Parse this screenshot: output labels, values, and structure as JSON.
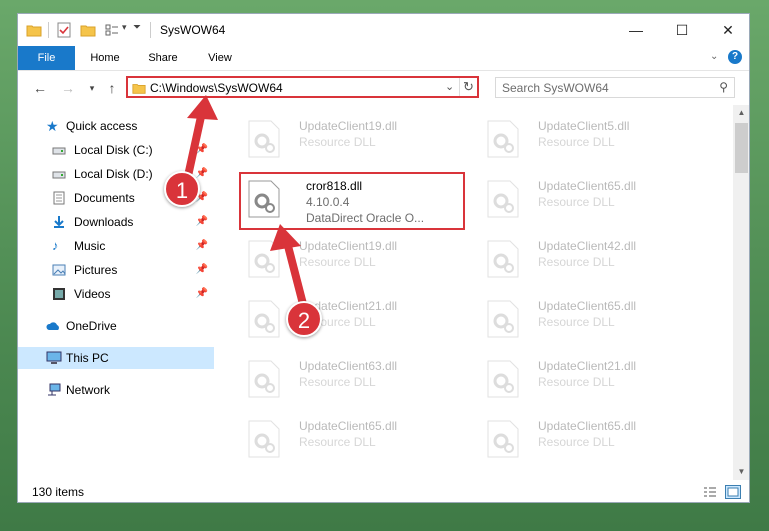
{
  "window": {
    "title": "SysWOW64"
  },
  "ribbon": {
    "tabs": [
      "File",
      "Home",
      "Share",
      "View"
    ]
  },
  "address": {
    "path": "C:\\Windows\\SysWOW64"
  },
  "search": {
    "placeholder": "Search SysWOW64"
  },
  "nav": {
    "items": [
      {
        "label": "Quick access",
        "icon": "star-icon"
      },
      {
        "label": "Local Disk (C:)",
        "icon": "drive-icon"
      },
      {
        "label": "Local Disk (D:)",
        "icon": "drive-icon"
      },
      {
        "label": "Documents",
        "icon": "documents-icon"
      },
      {
        "label": "Downloads",
        "icon": "downloads-icon"
      },
      {
        "label": "Music",
        "icon": "music-icon"
      },
      {
        "label": "Pictures",
        "icon": "pictures-icon"
      },
      {
        "label": "Videos",
        "icon": "videos-icon"
      },
      {
        "label": "OneDrive",
        "icon": "cloud-icon"
      },
      {
        "label": "This PC",
        "icon": "computer-icon"
      },
      {
        "label": "Network",
        "icon": "network-icon"
      }
    ]
  },
  "files": [
    {
      "name": "UpdateClient19.dll",
      "type": "Resource DLL"
    },
    {
      "name": "UpdateClient5.dll",
      "type": "Resource DLL"
    },
    {
      "name": "cror818.dll",
      "version": "4.10.0.4",
      "description": "DataDirect Oracle O..."
    },
    {
      "name": "UpdateClient65.dll",
      "type": "Resource DLL"
    },
    {
      "name": "UpdateClient19.dll",
      "type": "Resource DLL"
    },
    {
      "name": "UpdateClient42.dll",
      "type": "Resource DLL"
    },
    {
      "name": "UpdateClient21.dll",
      "type": "Resource DLL"
    },
    {
      "name": "UpdateClient65.dll",
      "type": "Resource DLL"
    },
    {
      "name": "UpdateClient63.dll",
      "type": "Resource DLL"
    },
    {
      "name": "UpdateClient21.dll",
      "type": "Resource DLL"
    },
    {
      "name": "UpdateClient65.dll",
      "type": "Resource DLL"
    },
    {
      "name": "UpdateClient65.dll",
      "type": "Resource DLL"
    }
  ],
  "status": {
    "count": "130 items"
  },
  "annotations": {
    "step1": "1",
    "step2": "2"
  },
  "colors": {
    "accent": "#1979ca",
    "highlight": "#d9343a",
    "selected": "#cce8ff"
  }
}
